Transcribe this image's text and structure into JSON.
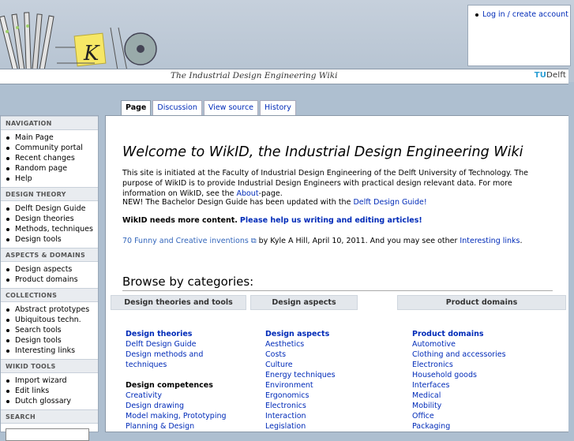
{
  "banner": {
    "tagline": "The Industrial Design Engineering Wiki",
    "tudelft_prefix": "TU",
    "tudelft_suffix": "Delft",
    "logo_letter": "K"
  },
  "personal": {
    "login_label": "Log in / create account"
  },
  "tabs": [
    "Page",
    "Discussion",
    "View source",
    "History"
  ],
  "sidebar": {
    "sections": [
      {
        "heading": "NAVIGATION",
        "items": [
          "Main Page",
          "Community portal",
          "Recent changes",
          "Random page",
          "Help"
        ]
      },
      {
        "heading": "DESIGN THEORY",
        "items": [
          "Delft Design Guide",
          "Design theories",
          "Methods, techniques",
          "Design tools"
        ]
      },
      {
        "heading": "ASPECTS & DOMAINS",
        "items": [
          "Design aspects",
          "Product domains"
        ]
      },
      {
        "heading": "COLLECTIONS",
        "items": [
          "Abstract prototypes",
          "Ubiquitous techn.",
          "Search tools",
          "Design tools",
          "Interesting links"
        ]
      },
      {
        "heading": "WIKID TOOLS",
        "items": [
          "Import wizard",
          "Edit links",
          "Dutch glossary"
        ]
      },
      {
        "heading": "SEARCH",
        "items": []
      }
    ]
  },
  "content": {
    "title": "Welcome to WikID, the Industrial Design Engineering Wiki",
    "intro_text": "This site is initiated at the Faculty of Industrial Design Engineering of the Delft University of Technology. The purpose of WikID is to provide Industrial Design Engineers with practical design relevant data. For more information on WikID, see the ",
    "intro_link": "About",
    "intro_end": "-page.",
    "news_text": "NEW! The Bachelor Design Guide has been updated with the ",
    "news_link": "Delft Design Guide!",
    "more_bold": "WikID needs more content.",
    "more_link": "Please help us writing and editing articles!",
    "ext_link": "70 Funny and Creative inventions",
    "ext_text": " by Kyle A Hill, April 10, 2011. And you may see other ",
    "ext_link2": "Interesting links",
    "ext_end": ".",
    "browse_heading": "Browse by categories:"
  },
  "categories": [
    {
      "header": "Design theories and tools",
      "groups": [
        {
          "title": "Design theories",
          "title_style": "bold",
          "items": [
            "Delft Design Guide",
            "Design methods and",
            "techniques"
          ]
        },
        {
          "title": "Design competences",
          "title_style": "black",
          "items": [
            "Creativity",
            "Design drawing",
            "Model making, Prototyping",
            "Planning & Design"
          ]
        }
      ]
    },
    {
      "header": "Design aspects",
      "groups": [
        {
          "title": "Design aspects",
          "title_style": "bold",
          "items": [
            "Aesthetics",
            "Costs",
            "Culture",
            "Energy techniques",
            "Environment",
            "Ergonomics",
            "Electronics",
            "Interaction",
            "Legislation"
          ]
        }
      ]
    },
    {
      "header": "Product domains",
      "groups": [
        {
          "title": "Product domains",
          "title_style": "bold",
          "items": [
            "Automotive",
            "Clothing and accessories",
            "Electronics",
            "Household goods",
            "Interfaces",
            "Medical",
            "Mobility",
            "Office",
            "Packaging"
          ]
        }
      ]
    }
  ]
}
